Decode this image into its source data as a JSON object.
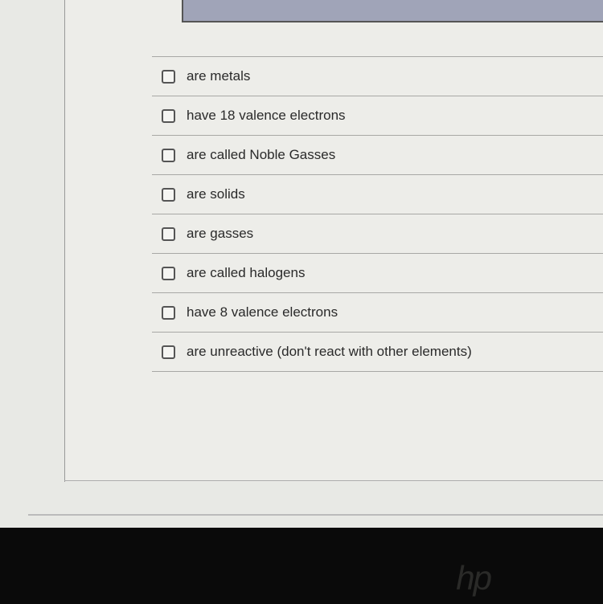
{
  "options": [
    {
      "label": "are metals"
    },
    {
      "label": "have 18 valence electrons"
    },
    {
      "label": "are called Noble Gasses"
    },
    {
      "label": "are solids"
    },
    {
      "label": "are gasses"
    },
    {
      "label": "are called halogens"
    },
    {
      "label": "have 8 valence electrons"
    },
    {
      "label": "are unreactive (don't react with other elements)"
    }
  ],
  "logo": "hp"
}
